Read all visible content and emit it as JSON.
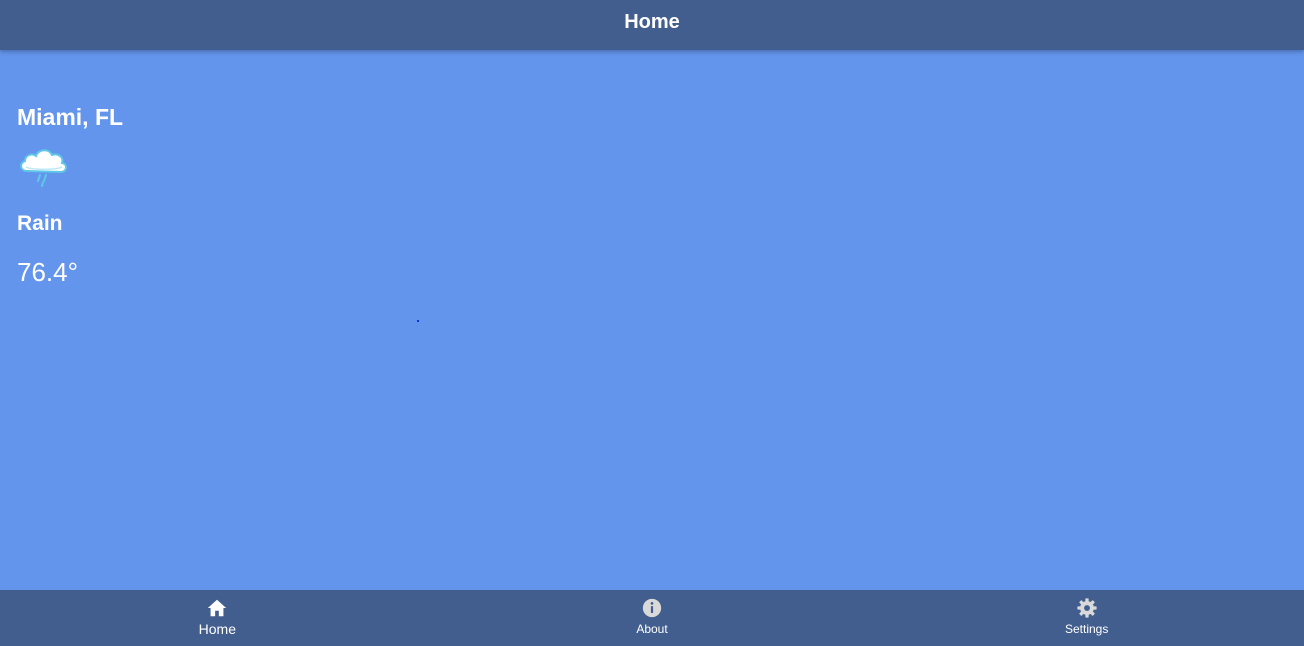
{
  "header": {
    "title": "Home"
  },
  "weather": {
    "city": "Miami, FL",
    "icon": "rain-cloud-icon",
    "condition": "Rain",
    "temperature": "76.4°"
  },
  "nav": {
    "items": [
      {
        "label": "Home",
        "icon": "home-icon",
        "active": true
      },
      {
        "label": "About",
        "icon": "info-icon",
        "active": false
      },
      {
        "label": "Settings",
        "icon": "gear-icon",
        "active": false
      }
    ]
  },
  "colors": {
    "background": "#6495ED",
    "bar": "#425E8F",
    "text": "#FFFFFF",
    "inactive_icon": "#D9D9D9"
  }
}
